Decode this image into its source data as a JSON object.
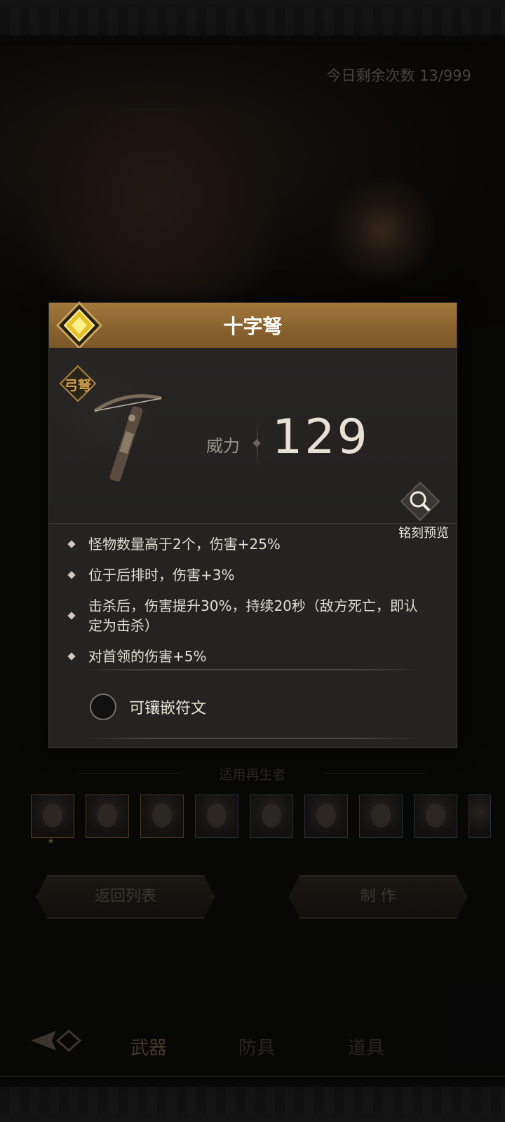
{
  "header": {
    "remaining_label": "今日剩余次数 13/999"
  },
  "modal": {
    "title": "十字弩",
    "weapon_type": "弓弩",
    "power_label": "威力",
    "power_value": "129",
    "preview_label": "铭刻预览",
    "perks": [
      "怪物数量高于2个，伤害+25%",
      "位于后排时，伤害+3%",
      "击杀后，伤害提升30%，持续20秒（敌方死亡，即认定为击杀）",
      "对首领的伤害+5%"
    ],
    "rune_label": "可镶嵌符文"
  },
  "background": {
    "regenerators_title": "适用再生者",
    "back_to_list": "返回列表",
    "craft": "制 作",
    "tabs": [
      "武器",
      "防具",
      "道具"
    ]
  },
  "colors": {
    "header_gold": "#8b6530",
    "type_badge": "#d7a34a",
    "modal_bg": "#242322"
  }
}
